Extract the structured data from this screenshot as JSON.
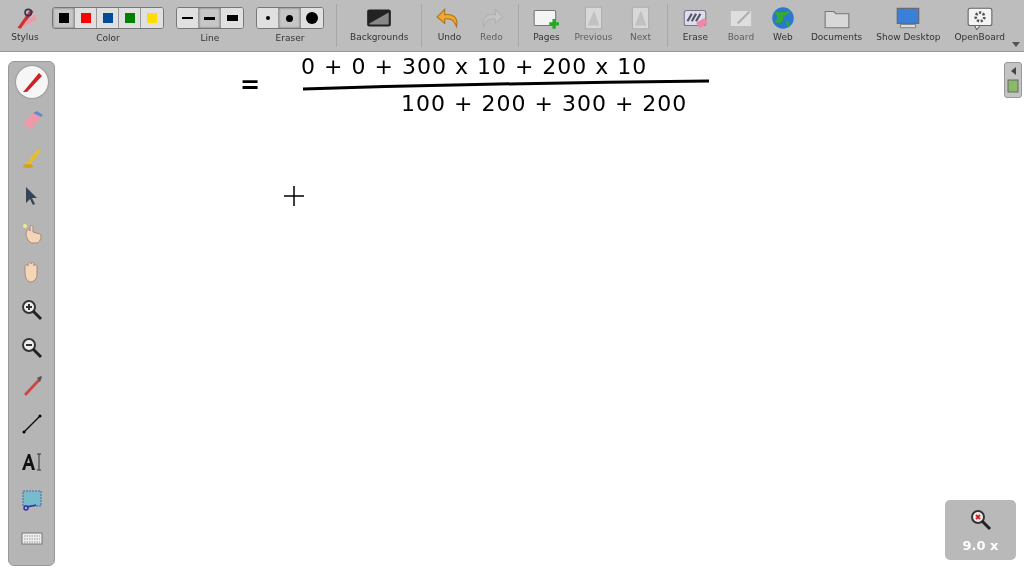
{
  "toolbar": {
    "stylus": {
      "label": "Stylus"
    },
    "color": {
      "label": "Color",
      "swatches": [
        {
          "color": "#000000",
          "selected": true
        },
        {
          "color": "#ff0000",
          "selected": false
        },
        {
          "color": "#004c99",
          "selected": false
        },
        {
          "color": "#008000",
          "selected": false
        },
        {
          "color": "#ffdd00",
          "selected": false
        }
      ]
    },
    "line": {
      "label": "Line",
      "widths": [
        {
          "selected": false
        },
        {
          "selected": true
        },
        {
          "selected": false
        }
      ]
    },
    "eraser": {
      "label": "Eraser",
      "sizes": [
        {
          "selected": false
        },
        {
          "selected": true
        },
        {
          "selected": false
        }
      ]
    },
    "buttons": [
      {
        "kind": "backgrounds",
        "label": "Backgrounds",
        "disabled": false
      },
      {
        "kind": "undo",
        "label": "Undo",
        "disabled": false
      },
      {
        "kind": "redo",
        "label": "Redo",
        "disabled": true
      },
      {
        "kind": "pages",
        "label": "Pages",
        "disabled": false
      },
      {
        "kind": "previous",
        "label": "Previous",
        "disabled": true
      },
      {
        "kind": "next",
        "label": "Next",
        "disabled": true
      },
      {
        "kind": "erase",
        "label": "Erase",
        "disabled": false
      }
    ],
    "modes": [
      {
        "kind": "board",
        "label": "Board",
        "disabled": true
      },
      {
        "kind": "web",
        "label": "Web",
        "disabled": false
      },
      {
        "kind": "documents",
        "label": "Documents",
        "disabled": false
      },
      {
        "kind": "desktop",
        "label": "Show Desktop",
        "disabled": false
      },
      {
        "kind": "openboard",
        "label": "OpenBoard",
        "disabled": false
      }
    ]
  },
  "tools": [
    {
      "kind": "pen",
      "selected": true
    },
    {
      "kind": "eraser",
      "selected": false
    },
    {
      "kind": "marker",
      "selected": false
    },
    {
      "kind": "selector",
      "selected": false
    },
    {
      "kind": "play",
      "selected": false
    },
    {
      "kind": "hand",
      "selected": false
    },
    {
      "kind": "zoomin",
      "selected": false
    },
    {
      "kind": "zoomout",
      "selected": false
    },
    {
      "kind": "laser",
      "selected": false
    },
    {
      "kind": "line",
      "selected": false
    },
    {
      "kind": "text",
      "selected": false
    },
    {
      "kind": "capture",
      "selected": false
    },
    {
      "kind": "keyboard",
      "selected": false
    }
  ],
  "board": {
    "equals": "=",
    "numerator": "0 + 0 + 300 x 10 + 200 x 10",
    "denominator": "100 + 200 + 300 + 200"
  },
  "zoom": {
    "reading": "9.0 x"
  }
}
